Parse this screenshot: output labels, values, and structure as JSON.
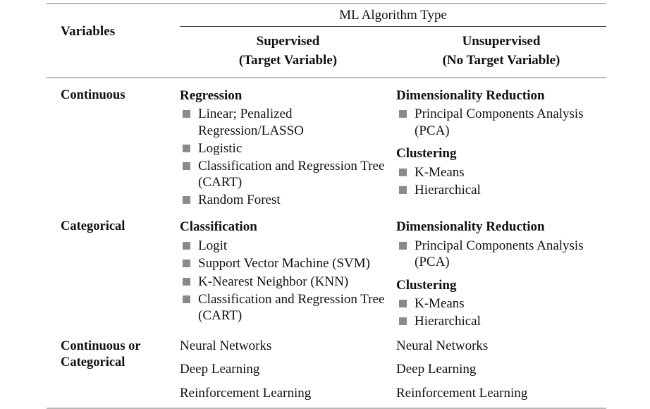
{
  "table": {
    "header": {
      "variables_label": "Variables",
      "span_title": "ML Algorithm Type",
      "supervised_line1": "Supervised",
      "supervised_line2": "(Target Variable)",
      "unsupervised_line1": "Unsupervised",
      "unsupervised_line2": "(No Target Variable)"
    },
    "rows": [
      {
        "variable": "Continuous",
        "supervised": {
          "groups": [
            {
              "title": "Regression",
              "items": [
                "Linear; Penalized Regression/LASSO",
                "Logistic",
                "Classification and Regression Tree (CART)",
                "Random Forest"
              ]
            }
          ]
        },
        "unsupervised": {
          "groups": [
            {
              "title": "Dimensionality Reduction",
              "items": [
                "Principal Components Analysis (PCA)"
              ]
            },
            {
              "title": "Clustering",
              "items": [
                "K-Means",
                "Hierarchical"
              ]
            }
          ]
        }
      },
      {
        "variable": "Categorical",
        "supervised": {
          "groups": [
            {
              "title": "Classification",
              "items": [
                "Logit",
                "Support Vector Machine (SVM)",
                "K-Nearest Neighbor (KNN)",
                "Classification and Regression Tree (CART)"
              ]
            }
          ]
        },
        "unsupervised": {
          "groups": [
            {
              "title": "Dimensionality Reduction",
              "items": [
                "Principal Components Analysis (PCA)"
              ]
            },
            {
              "title": "Clustering",
              "items": [
                "K-Means",
                "Hierarchical"
              ]
            }
          ]
        }
      },
      {
        "variable": "Continuous or Categorical",
        "supervised": {
          "plain_items": [
            "Neural Networks",
            "Deep Learning",
            "Reinforcement Learning"
          ]
        },
        "unsupervised": {
          "plain_items": [
            "Neural Networks",
            "Deep Learning",
            "Reinforcement Learning"
          ]
        }
      }
    ]
  }
}
